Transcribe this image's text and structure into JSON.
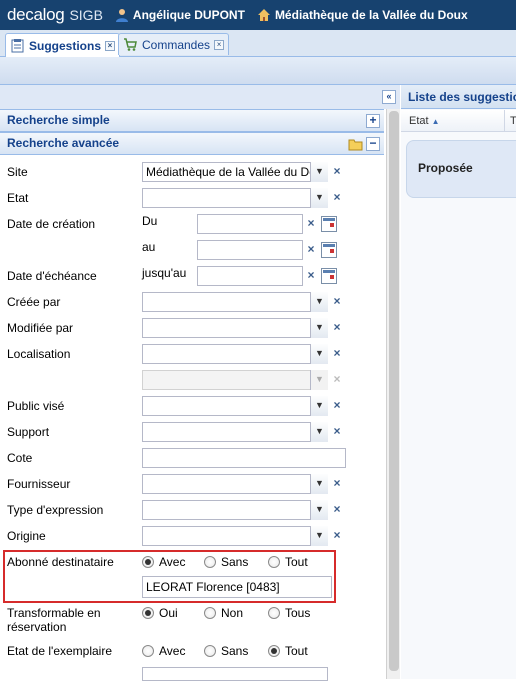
{
  "header": {
    "logo": "decalog",
    "logo_suffix": "SIGB",
    "user": "Angélique DUPONT",
    "library": "Médiathèque de la Vallée du Doux"
  },
  "tabs": [
    {
      "label": "Suggestions",
      "active": true
    },
    {
      "label": "Commandes",
      "active": false
    }
  ],
  "search": {
    "simple_title": "Recherche simple",
    "advanced_title": "Recherche avancée",
    "site": {
      "label": "Site",
      "value": "Médiathèque de la Vallée du Doux"
    },
    "etat": {
      "label": "Etat",
      "value": ""
    },
    "date_creation": {
      "label": "Date de création",
      "from": "Du",
      "to": "au"
    },
    "date_echeance": {
      "label": "Date d'échéance",
      "until": "jusqu'au"
    },
    "creee_par": {
      "label": "Créée par"
    },
    "modifiee_par": {
      "label": "Modifiée par"
    },
    "localisation": {
      "label": "Localisation"
    },
    "public_vise": {
      "label": "Public visé"
    },
    "support": {
      "label": "Support"
    },
    "cote": {
      "label": "Cote"
    },
    "fournisseur": {
      "label": "Fournisseur"
    },
    "type_expression": {
      "label": "Type d'expression"
    },
    "origine": {
      "label": "Origine"
    },
    "abonne": {
      "label": "Abonné destinataire",
      "options": [
        "Avec",
        "Sans",
        "Tout"
      ],
      "selected": "Avec",
      "value": "LEORAT Florence [0483]"
    },
    "transformable": {
      "label_line1": "Transformable en",
      "label_line2": "réservation",
      "options": [
        "Oui",
        "Non",
        "Tous"
      ],
      "selected": "Oui"
    },
    "etat_exemplaire": {
      "label": "Etat de l'exemplaire",
      "options": [
        "Avec",
        "Sans",
        "Tout"
      ],
      "selected": "Tout"
    }
  },
  "results": {
    "title": "Liste des suggestions",
    "column_etat": "Etat",
    "column_t": "T",
    "group": "Proposée"
  },
  "colors": {
    "header_bg": "#17426f",
    "accent": "#15428b",
    "highlight": "#d62b2b"
  }
}
